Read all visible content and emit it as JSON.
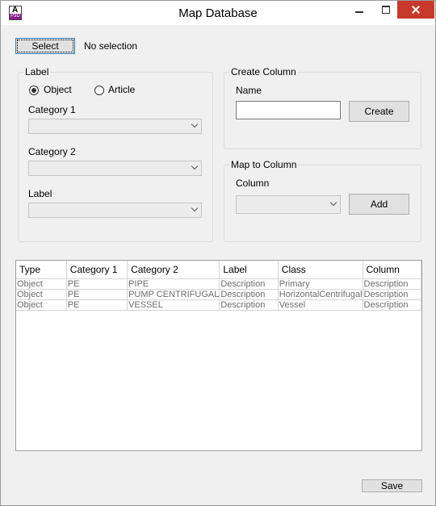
{
  "window": {
    "title": "Map Database",
    "icon_letter": "A",
    "icon_sub": "P3D"
  },
  "toolbar": {
    "select_label": "Select",
    "selection_status": "No selection"
  },
  "label_group": {
    "legend": "Label",
    "radio_object": "Object",
    "radio_article": "Article",
    "selected_radio": "Object",
    "category1_label": "Category 1",
    "category1_value": "",
    "category2_label": "Category 2",
    "category2_value": "",
    "label_label": "Label",
    "label_value": ""
  },
  "create_column": {
    "legend": "Create Column",
    "name_label": "Name",
    "name_value": "",
    "create_label": "Create"
  },
  "map_to_column": {
    "legend": "Map to Column",
    "column_label": "Column",
    "column_value": "",
    "add_label": "Add"
  },
  "grid": {
    "columns": [
      "Type",
      "Category 1",
      "Category 2",
      "Label",
      "Class",
      "Column"
    ],
    "rows": [
      [
        "Object",
        "PE",
        "PIPE",
        "Description",
        "Primary",
        "Description"
      ],
      [
        "Object",
        "PE",
        "PUMP CENTRIFUGAL",
        "Description",
        "HorizontalCentrifugal",
        "Description"
      ],
      [
        "Object",
        "PE",
        "VESSEL",
        "Description",
        "Vessel",
        "Description"
      ]
    ]
  },
  "footer": {
    "save_label": "Save"
  }
}
